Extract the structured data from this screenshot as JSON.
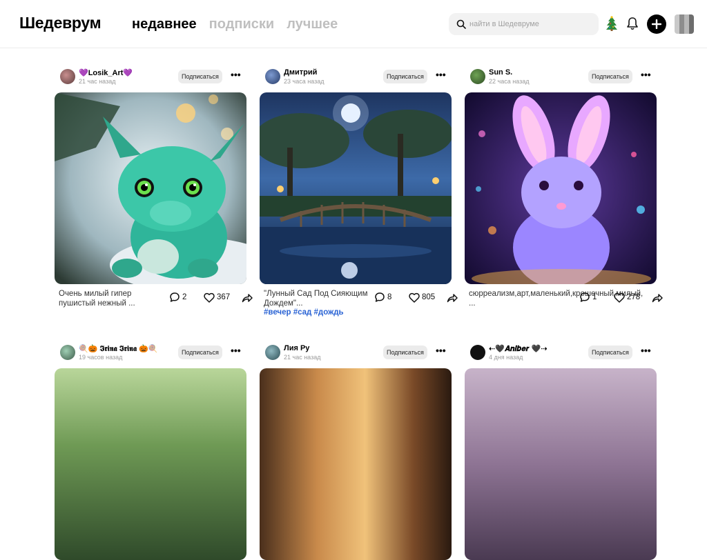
{
  "header": {
    "logo": "Шедеврум",
    "tabs": [
      "недавнее",
      "подписки",
      "лучшее"
    ],
    "search_placeholder": "найти в Шедевруме"
  },
  "feed": {
    "subscribe_label": "Подписаться",
    "more_label": "•••",
    "posts": [
      {
        "user": "💜Losik_Art💜",
        "time": "21 час назад",
        "caption": "Очень милый гипер пушистый нежный ...",
        "hashtags": "",
        "comments": "2",
        "likes": "367"
      },
      {
        "user": "Дмитрий",
        "time": "23 часа назад",
        "caption": "\"Лунный Сад Под Сияющим Дождем\"...",
        "hashtags": "#вечер #сад #дождь",
        "comments": "8",
        "likes": "805"
      },
      {
        "user": "Sun S.",
        "time": "22 часа назад",
        "caption": "сюрреализм,арт,маленький,крошечный,милый, ...",
        "hashtags": "",
        "comments": "1",
        "likes": "278"
      },
      {
        "user": "🍭🎃 𝕴𝖗𝖎𝖓𝖆 𝕴𝖗𝖎𝖓𝖆 🎃🍭",
        "time": "19 часов назад",
        "caption": "",
        "hashtags": "",
        "comments": "",
        "likes": ""
      },
      {
        "user": "Лия Ру",
        "time": "21 час назад",
        "caption": "",
        "hashtags": "",
        "comments": "",
        "likes": ""
      },
      {
        "user": "⇠🖤𝑨𝒏𝒊𝒃𝒆𝒓 🖤⇢",
        "time": "4 дня назад",
        "caption": "",
        "hashtags": "",
        "comments": "",
        "likes": ""
      }
    ]
  },
  "icons": {
    "search": "search-icon",
    "tree": "christmas-tree-icon",
    "bell": "bell-icon",
    "plus": "plus-icon",
    "comment": "comment-icon",
    "like": "heart-icon",
    "share": "share-icon"
  },
  "colors": {
    "hashtag": "#2a63d4",
    "tab_inactive": "#bfbfbf",
    "subscribe_bg": "#ebebeb"
  }
}
